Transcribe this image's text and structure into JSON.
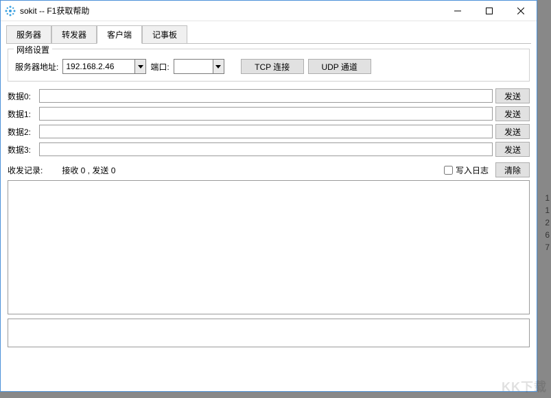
{
  "window": {
    "title": "sokit -- F1获取帮助"
  },
  "tabs": {
    "server": "服务器",
    "forwarder": "转发器",
    "client": "客户端",
    "notepad": "记事板"
  },
  "network": {
    "group_label": "网络设置",
    "server_addr_label": "服务器地址:",
    "server_addr_value": "192.168.2.46",
    "port_label": "端口:",
    "port_value": "",
    "tcp_btn": "TCP 连接",
    "udp_btn": "UDP 通道"
  },
  "datarows": [
    {
      "label": "数据0:",
      "value": "",
      "send": "发送"
    },
    {
      "label": "数据1:",
      "value": "",
      "send": "发送"
    },
    {
      "label": "数据2:",
      "value": "",
      "send": "发送"
    },
    {
      "label": "数据3:",
      "value": "",
      "send": "发送"
    }
  ],
  "log": {
    "title": "收发记录:",
    "stats": "接收 0 , 发送 0",
    "write_log_label": "写入日志",
    "clear_btn": "清除"
  },
  "side_numbers": [
    "1",
    "1",
    "2",
    "6",
    "7"
  ],
  "watermark": "KK下载"
}
